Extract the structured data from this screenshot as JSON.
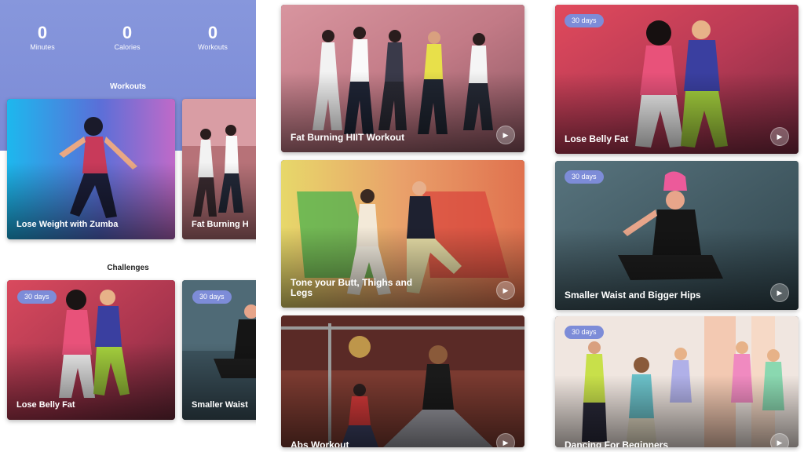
{
  "stats": [
    {
      "value": "0",
      "label": "Minutes"
    },
    {
      "value": "0",
      "label": "Calories"
    },
    {
      "value": "0",
      "label": "Workouts"
    }
  ],
  "sections": {
    "workouts": "Workouts",
    "challenges": "Challenges"
  },
  "left_workouts": [
    {
      "title": "Lose Weight with Zumba"
    },
    {
      "title": "Fat Burning H"
    }
  ],
  "left_challenges": [
    {
      "title": "Lose Belly Fat",
      "badge": "30 days"
    },
    {
      "title": "Smaller Waist",
      "badge": "30 days"
    }
  ],
  "middle_column": [
    {
      "title": "Fat Burning HIIT Workout"
    },
    {
      "title": "Tone your Butt, Thighs and Legs"
    },
    {
      "title": "Abs Workout"
    }
  ],
  "right_column": [
    {
      "title": "Lose Belly Fat",
      "badge": "30 days"
    },
    {
      "title": "Smaller Waist and Bigger Hips",
      "badge": "30 days"
    },
    {
      "title": "Dancing For Beginners",
      "badge": "30 days"
    }
  ],
  "play_glyph": "▶",
  "colors": {
    "accent": "#7d8cd8",
    "header": "#8797dc"
  }
}
